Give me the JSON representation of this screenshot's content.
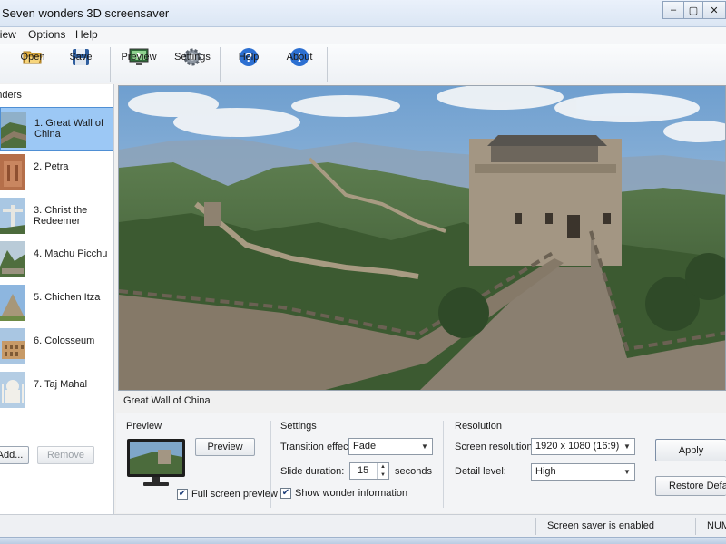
{
  "window": {
    "title": "Seven wonders 3D screensaver",
    "minimize": "–",
    "maximize": "▢",
    "close": "✕"
  },
  "menu": {
    "view": "View",
    "options": "Options",
    "help": "Help"
  },
  "toolbar": {
    "open": "Open",
    "save": "Save",
    "preview": "Preview",
    "settings": "Settings",
    "help": "Help",
    "about": "About"
  },
  "wonders_panel": {
    "header": "Wonders",
    "items": [
      {
        "label": "1. Great Wall of China",
        "selected": true
      },
      {
        "label": "2. Petra"
      },
      {
        "label": "3. Christ the Redeemer"
      },
      {
        "label": "4. Machu Picchu"
      },
      {
        "label": "5. Chichen Itza"
      },
      {
        "label": "6. Colosseum"
      },
      {
        "label": "7. Taj Mahal"
      }
    ],
    "add_button": "Add...",
    "remove_button": "Remove"
  },
  "main": {
    "caption": "Great Wall of China"
  },
  "preview_group": {
    "title": "Preview",
    "preview_button": "Preview",
    "fullscreen_label": "Full screen preview",
    "fullscreen_checked": true
  },
  "settings_group": {
    "title": "Settings",
    "transition_label": "Transition effect:",
    "transition_value": "Fade",
    "duration_label": "Slide duration:",
    "duration_value": "15",
    "duration_unit": "seconds",
    "show_info_label": "Show wonder information",
    "show_info_checked": true
  },
  "resolution_group": {
    "title": "Resolution",
    "screen_res_label": "Screen resolution:",
    "screen_res_value": "1920 x 1080 (16:9)",
    "detail_label": "Detail level:",
    "detail_value": "High"
  },
  "actions": {
    "apply": "Apply",
    "restore": "Restore Defaults"
  },
  "status": {
    "message": "Screen saver is enabled",
    "num": "NUM"
  }
}
